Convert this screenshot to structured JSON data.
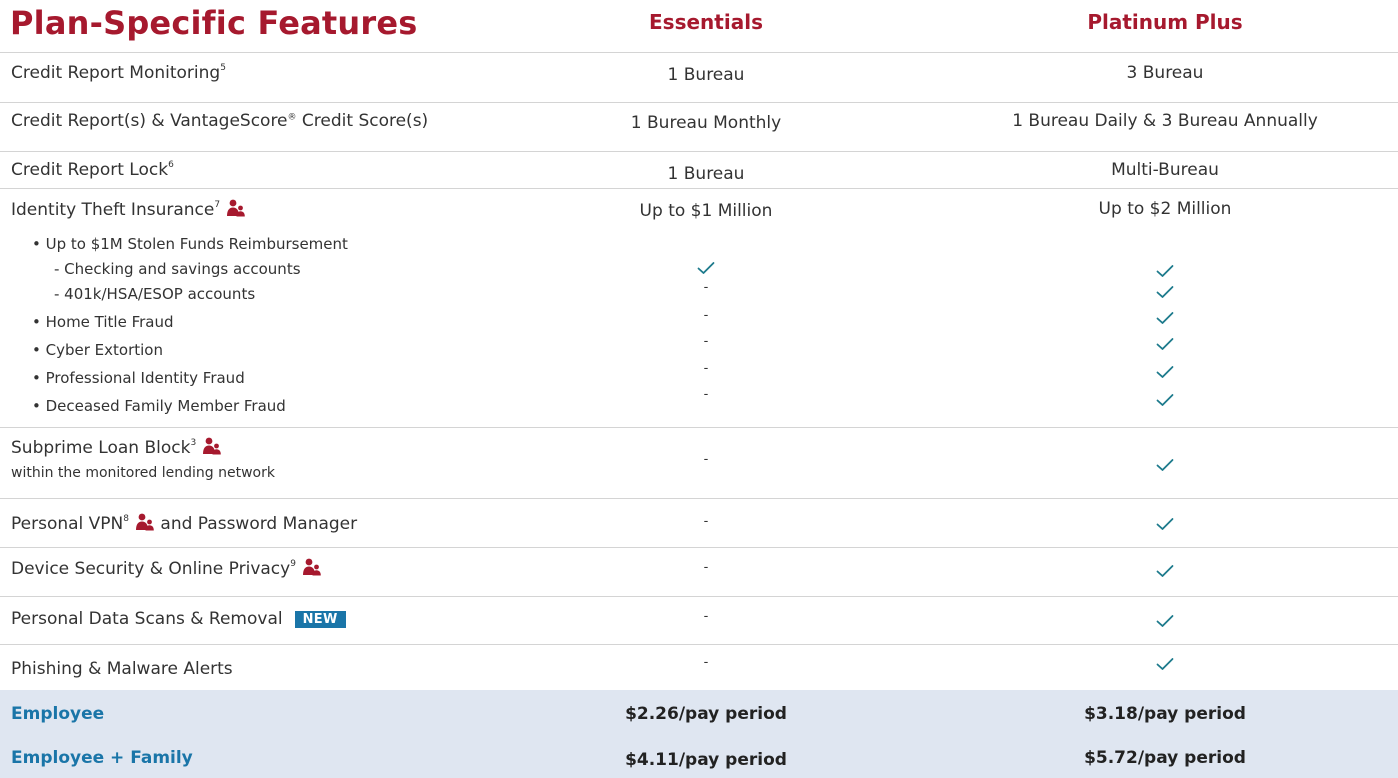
{
  "header": {
    "title": "Plan-Specific Features",
    "plans": [
      "Essentials",
      "Platinum Plus"
    ]
  },
  "features": {
    "credit_monitoring": {
      "label": "Credit Report Monitoring",
      "footnote": "5",
      "essentials": "1 Bureau",
      "platinum": "3 Bureau"
    },
    "credit_reports": {
      "label_a": "Credit Report(s)  & VantageScore",
      "reg": "®",
      "label_b": " Credit Score(s)",
      "essentials": "1 Bureau Monthly",
      "platinum": "1 Bureau Daily & 3 Bureau Annually"
    },
    "credit_lock": {
      "label": "Credit Report Lock",
      "footnote": "6",
      "essentials": "1 Bureau",
      "platinum": "Multi-Bureau"
    },
    "id_insurance": {
      "label": "Identity Theft Insurance",
      "footnote": "7",
      "icon": "family-icon",
      "essentials": "Up to $1 Million",
      "platinum": "Up to $2 Million",
      "sub_items": [
        {
          "label": "• Up to $1M Stolen Funds Reimbursement",
          "indent": 1,
          "essentials": "",
          "platinum": ""
        },
        {
          "label": "- Checking and savings accounts",
          "indent": 2,
          "essentials": "check",
          "platinum": "check"
        },
        {
          "label": "- 401k/HSA/ESOP accounts",
          "indent": 2,
          "essentials": "-",
          "platinum": "check"
        },
        {
          "label": "• Home Title Fraud",
          "indent": 1,
          "essentials": "-",
          "platinum": "check"
        },
        {
          "label": "• Cyber Extortion",
          "indent": 1,
          "essentials": "-",
          "platinum": "check"
        },
        {
          "label": "• Professional Identity Fraud",
          "indent": 1,
          "essentials": "-",
          "platinum": "check"
        },
        {
          "label": "• Deceased Family Member Fraud",
          "indent": 1,
          "essentials": "-",
          "platinum": "check"
        }
      ]
    },
    "subprime": {
      "label": "Subprime Loan Block",
      "footnote": "3",
      "sublabel": "within the monitored lending network",
      "essentials": "-",
      "platinum": "check"
    },
    "vpn": {
      "label_a": "Personal VPN",
      "footnote": "8",
      "label_b": "and Password Manager",
      "essentials": "-",
      "platinum": "check"
    },
    "device": {
      "label": "Device Security & Online Privacy",
      "footnote": "9",
      "essentials": "-",
      "platinum": "check"
    },
    "data_scans": {
      "label": "Personal Data Scans & Removal",
      "badge": "NEW",
      "essentials": "-",
      "platinum": "check"
    },
    "phishing": {
      "label": "Phishing & Malware Alerts",
      "essentials": "-",
      "platinum": "check"
    }
  },
  "pricing": [
    {
      "label": "Employee",
      "essentials": "$2.26/pay period",
      "platinum": "$3.18/pay period"
    },
    {
      "label": "Employee + Family",
      "essentials": "$4.11/pay period",
      "platinum": "$5.72/pay period"
    }
  ],
  "colors": {
    "accent_red": "#a6192e",
    "accent_blue": "#1a75a8",
    "check_teal": "#1d7a8c",
    "footer_bg": "#dfe6f1"
  }
}
